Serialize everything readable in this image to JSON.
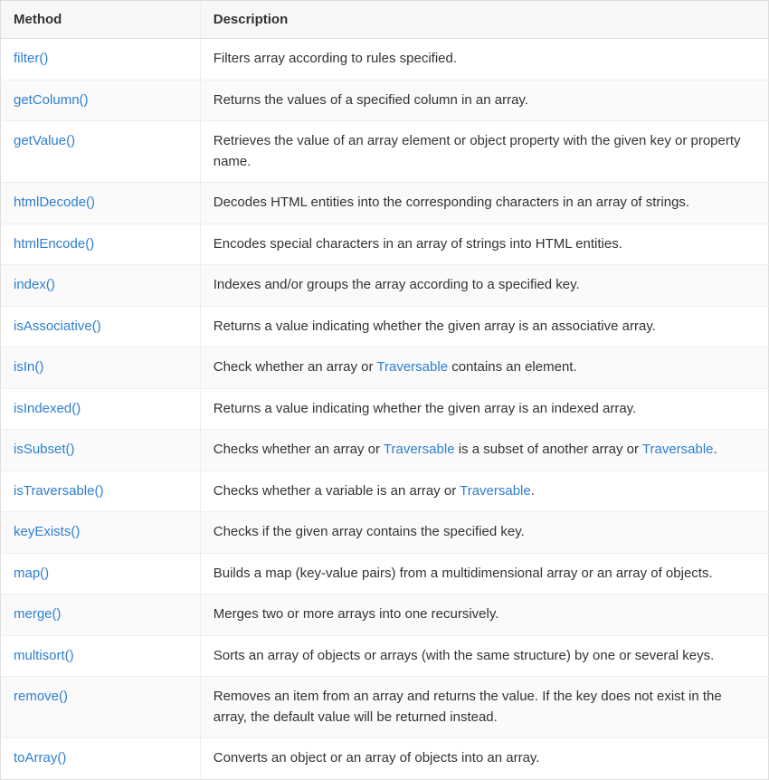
{
  "headers": {
    "method": "Method",
    "description": "Description"
  },
  "link_text": {
    "traversable": "Traversable"
  },
  "rows": [
    {
      "method": "filter()",
      "desc_before": "Filters array according to rules specified.",
      "link": null,
      "desc_mid": "",
      "link2": null,
      "desc_after": ""
    },
    {
      "method": "getColumn()",
      "desc_before": "Returns the values of a specified column in an array.",
      "link": null,
      "desc_mid": "",
      "link2": null,
      "desc_after": ""
    },
    {
      "method": "getValue()",
      "desc_before": "Retrieves the value of an array element or object property with the given key or property name.",
      "link": null,
      "desc_mid": "",
      "link2": null,
      "desc_after": ""
    },
    {
      "method": "htmlDecode()",
      "desc_before": "Decodes HTML entities into the corresponding characters in an array of strings.",
      "link": null,
      "desc_mid": "",
      "link2": null,
      "desc_after": ""
    },
    {
      "method": "htmlEncode()",
      "desc_before": "Encodes special characters in an array of strings into HTML entities.",
      "link": null,
      "desc_mid": "",
      "link2": null,
      "desc_after": ""
    },
    {
      "method": "index()",
      "desc_before": "Indexes and/or groups the array according to a specified key.",
      "link": null,
      "desc_mid": "",
      "link2": null,
      "desc_after": ""
    },
    {
      "method": "isAssociative()",
      "desc_before": "Returns a value indicating whether the given array is an associative array.",
      "link": null,
      "desc_mid": "",
      "link2": null,
      "desc_after": ""
    },
    {
      "method": "isIn()",
      "desc_before": "Check whether an array or ",
      "link": "traversable",
      "desc_mid": " contains an element.",
      "link2": null,
      "desc_after": ""
    },
    {
      "method": "isIndexed()",
      "desc_before": "Returns a value indicating whether the given array is an indexed array.",
      "link": null,
      "desc_mid": "",
      "link2": null,
      "desc_after": ""
    },
    {
      "method": "isSubset()",
      "desc_before": "Checks whether an array or ",
      "link": "traversable",
      "desc_mid": " is a subset of another array or ",
      "link2": "traversable",
      "desc_after": "."
    },
    {
      "method": "isTraversable()",
      "desc_before": "Checks whether a variable is an array or ",
      "link": "traversable",
      "desc_mid": ".",
      "link2": null,
      "desc_after": ""
    },
    {
      "method": "keyExists()",
      "desc_before": "Checks if the given array contains the specified key.",
      "link": null,
      "desc_mid": "",
      "link2": null,
      "desc_after": ""
    },
    {
      "method": "map()",
      "desc_before": "Builds a map (key-value pairs) from a multidimensional array or an array of objects.",
      "link": null,
      "desc_mid": "",
      "link2": null,
      "desc_after": ""
    },
    {
      "method": "merge()",
      "desc_before": "Merges two or more arrays into one recursively.",
      "link": null,
      "desc_mid": "",
      "link2": null,
      "desc_after": ""
    },
    {
      "method": "multisort()",
      "desc_before": "Sorts an array of objects or arrays (with the same structure) by one or several keys.",
      "link": null,
      "desc_mid": "",
      "link2": null,
      "desc_after": ""
    },
    {
      "method": "remove()",
      "desc_before": "Removes an item from an array and returns the value. If the key does not exist in the array, the default value will be returned instead.",
      "link": null,
      "desc_mid": "",
      "link2": null,
      "desc_after": ""
    },
    {
      "method": "toArray()",
      "desc_before": "Converts an object or an array of objects into an array.",
      "link": null,
      "desc_mid": "",
      "link2": null,
      "desc_after": ""
    }
  ]
}
